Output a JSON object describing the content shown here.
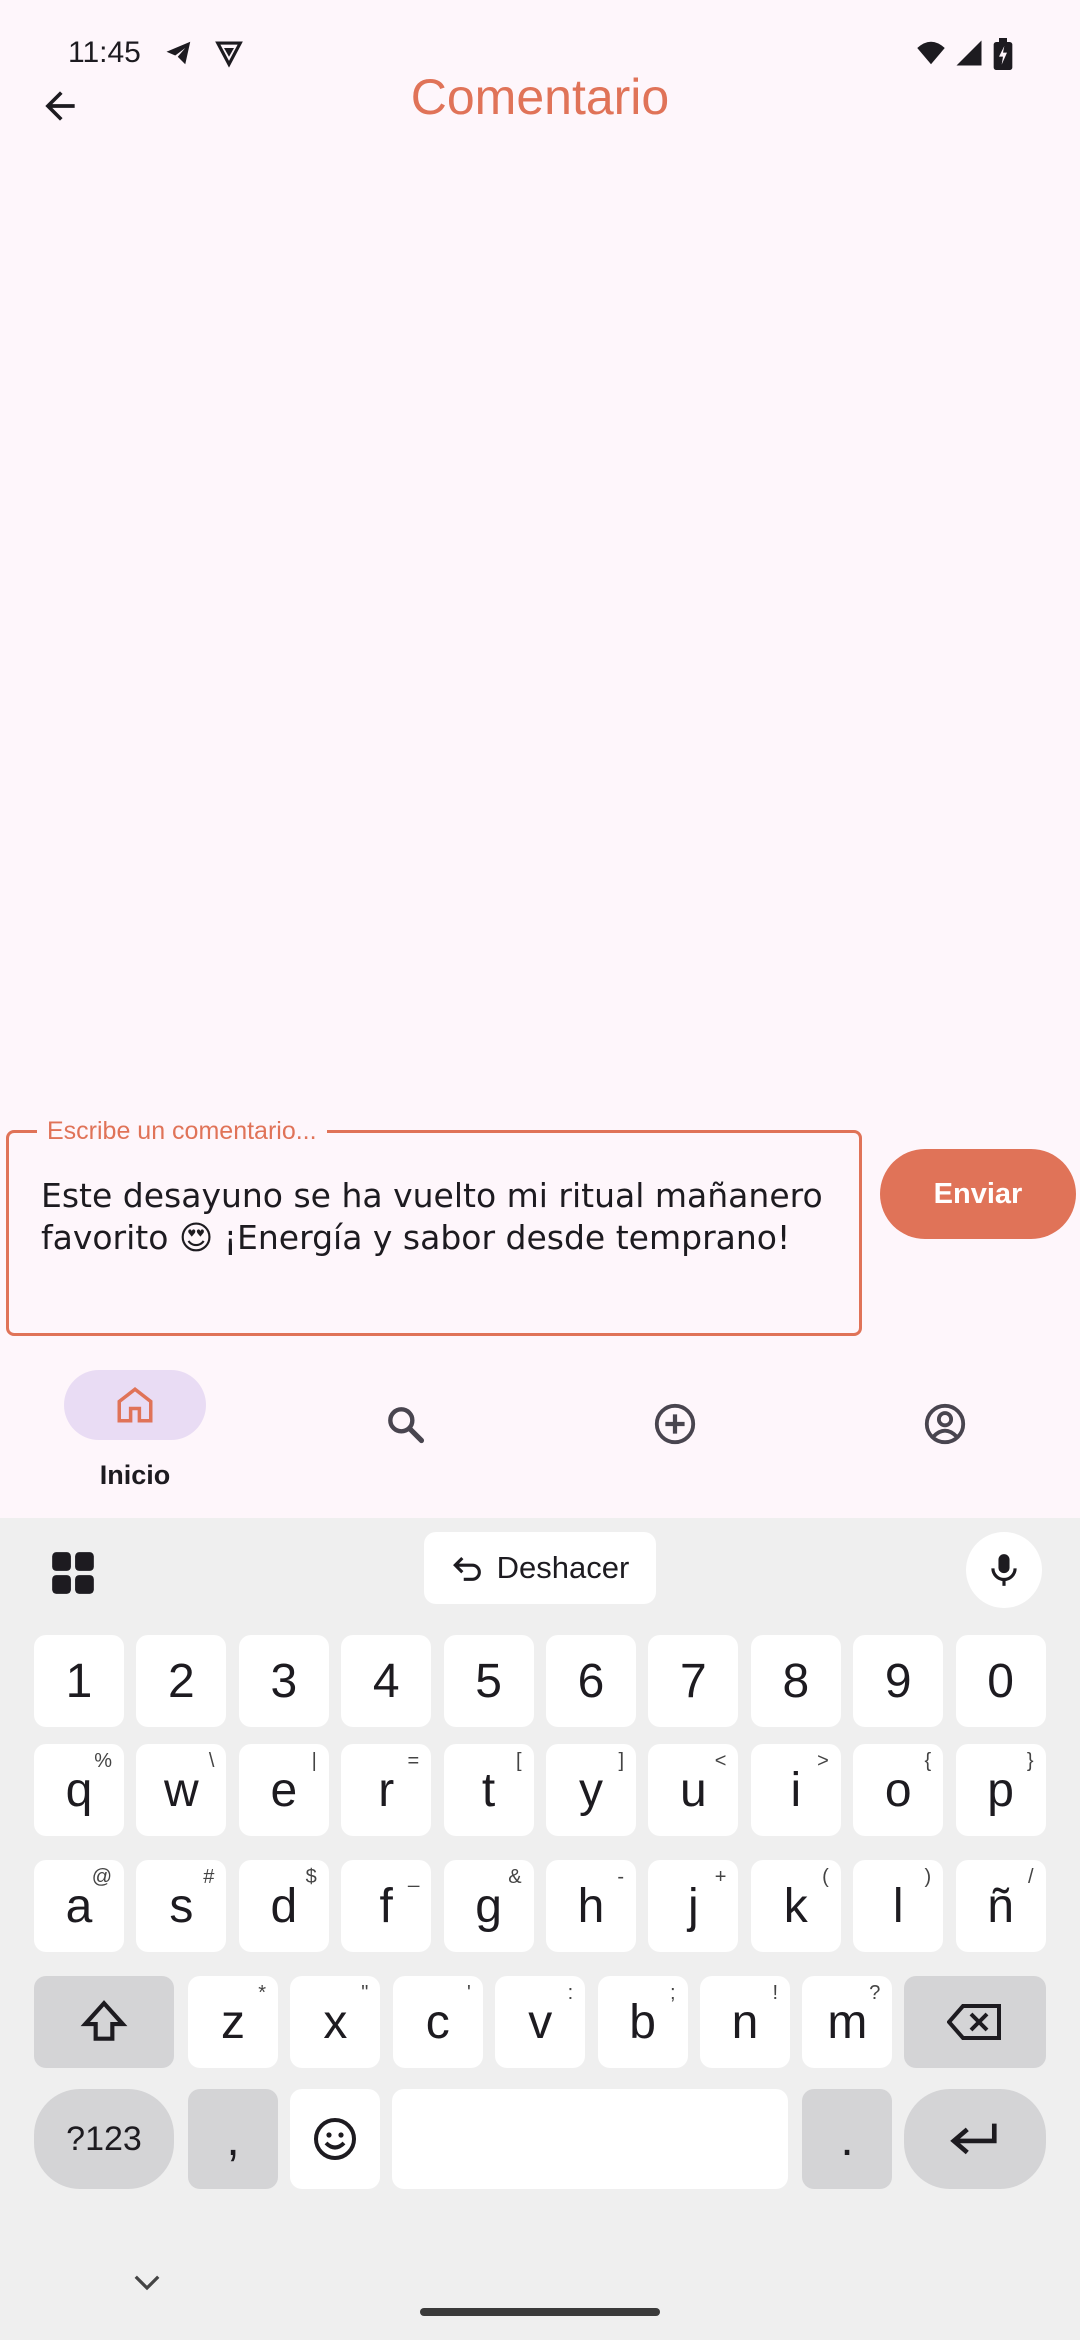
{
  "status": {
    "time": "11:45"
  },
  "appbar": {
    "title": "Comentario"
  },
  "comment": {
    "label": "Escribe un comentario...",
    "value": "Este desayuno se ha vuelto mi ritual mañanero favorito 😍 ¡Energía y sabor desde temprano!"
  },
  "send_label": "Enviar",
  "nav": {
    "items": [
      {
        "label": "Inicio",
        "icon": "home-icon",
        "selected": true
      },
      {
        "label": "",
        "icon": "search-icon"
      },
      {
        "label": "",
        "icon": "add-circle-icon"
      },
      {
        "label": "",
        "icon": "account-icon"
      }
    ]
  },
  "keyboard": {
    "undo_label": "Deshacer",
    "row_numbers": [
      "1",
      "2",
      "3",
      "4",
      "5",
      "6",
      "7",
      "8",
      "9",
      "0"
    ],
    "row1": [
      {
        "k": "q",
        "s": "%"
      },
      {
        "k": "w",
        "s": "\\"
      },
      {
        "k": "e",
        "s": "|"
      },
      {
        "k": "r",
        "s": "="
      },
      {
        "k": "t",
        "s": "["
      },
      {
        "k": "y",
        "s": "]"
      },
      {
        "k": "u",
        "s": "<"
      },
      {
        "k": "i",
        "s": ">"
      },
      {
        "k": "o",
        "s": "{"
      },
      {
        "k": "p",
        "s": "}"
      }
    ],
    "row2": [
      {
        "k": "a",
        "s": "@"
      },
      {
        "k": "s",
        "s": "#"
      },
      {
        "k": "d",
        "s": "$"
      },
      {
        "k": "f",
        "s": "_"
      },
      {
        "k": "g",
        "s": "&"
      },
      {
        "k": "h",
        "s": "-"
      },
      {
        "k": "j",
        "s": "+"
      },
      {
        "k": "k",
        "s": "("
      },
      {
        "k": "l",
        "s": ")"
      },
      {
        "k": "ñ",
        "s": "/"
      }
    ],
    "row3": [
      {
        "k": "z",
        "s": "*"
      },
      {
        "k": "x",
        "s": "\""
      },
      {
        "k": "c",
        "s": "'"
      },
      {
        "k": "v",
        "s": ":"
      },
      {
        "k": "b",
        "s": ";"
      },
      {
        "k": "n",
        "s": "!"
      },
      {
        "k": "m",
        "s": "?"
      }
    ],
    "symbols_label": "?123",
    "comma": ",",
    "period": "."
  },
  "colors": {
    "accent": "#e07358",
    "background": "#fef6fb",
    "nav_pill": "#e9dcf4"
  }
}
